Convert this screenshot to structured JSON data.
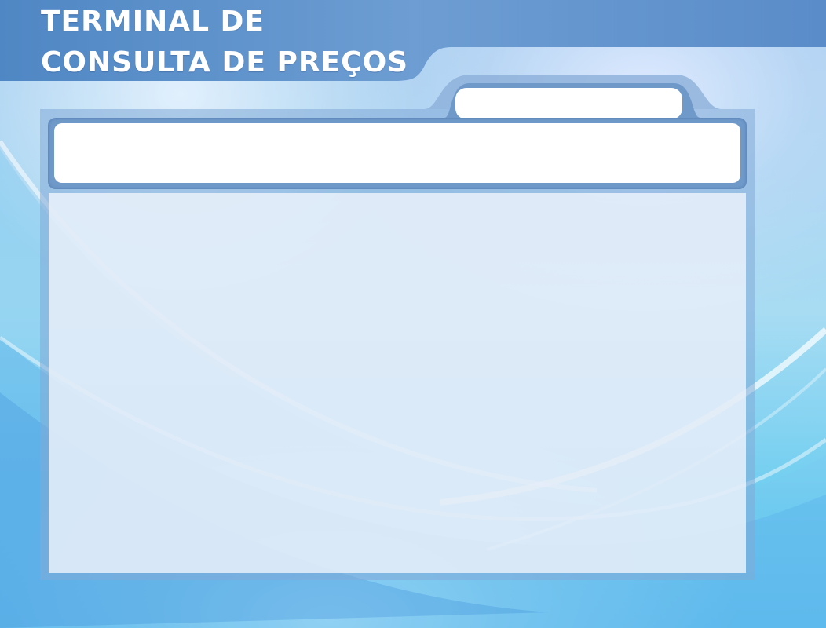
{
  "app": {
    "title_line1": "TERMINAL DE",
    "title_line2": "CONSULTA DE PREÇOS"
  },
  "lookup_tab": {
    "value": "",
    "placeholder": ""
  },
  "product_bar": {
    "value": "",
    "placeholder": ""
  },
  "details": {
    "text": ""
  },
  "colors": {
    "banner": "#5b8fc9",
    "frame": "#6f99c9",
    "field": "#ffffff",
    "content": "#eef3fa"
  }
}
